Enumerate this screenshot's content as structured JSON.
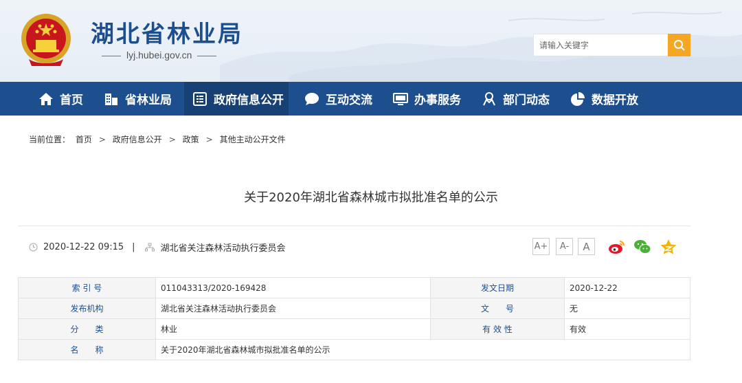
{
  "header": {
    "site_title": "湖北省林业局",
    "site_url": "lyj.hubei.gov.cn",
    "search_placeholder": "请输入关键字"
  },
  "nav": {
    "items": [
      {
        "label": "首页",
        "icon": "home-icon"
      },
      {
        "label": "省林业局",
        "icon": "building-icon"
      },
      {
        "label": "政府信息公开",
        "icon": "document-list-icon"
      },
      {
        "label": "互动交流",
        "icon": "chat-bubble-icon"
      },
      {
        "label": "办事服务",
        "icon": "monitor-icon"
      },
      {
        "label": "部门动态",
        "icon": "person-icon"
      },
      {
        "label": "数据开放",
        "icon": "pie-chart-icon"
      }
    ],
    "active_index": 2
  },
  "breadcrumb": {
    "prefix": "当前位置：",
    "items": [
      "首页",
      "政府信息公开",
      "政策",
      "其他主动公开文件"
    ],
    "separator": ">"
  },
  "article": {
    "title": "关于2020年湖北省森林城市拟批准名单的公示",
    "datetime": "2020-12-22 09:15",
    "divider": "|",
    "publisher": "湖北省关注森林活动执行委员会",
    "font_buttons": [
      "A+",
      "A-",
      "A"
    ]
  },
  "info_table": {
    "rows": [
      {
        "k1": "索 引 号",
        "v1": "011043313/2020-169428",
        "k2": "发文日期",
        "v2": "2020-12-22"
      },
      {
        "k1": "发布机构",
        "v1": "湖北省关注森林活动执行委员会",
        "k2": "文　　号",
        "v2": "无"
      },
      {
        "k1": "分　　类",
        "v1": "林业",
        "k2": "有 效 性",
        "v2": "有效"
      },
      {
        "k1": "名　　称",
        "v1": "关于2020年湖北省森林城市拟批准名单的公示"
      }
    ]
  },
  "colors": {
    "nav_bg": "#1d4f8f",
    "nav_active_bg": "#174174",
    "search_button": "#f5a623",
    "table_key_text": "#1d4f8f"
  }
}
